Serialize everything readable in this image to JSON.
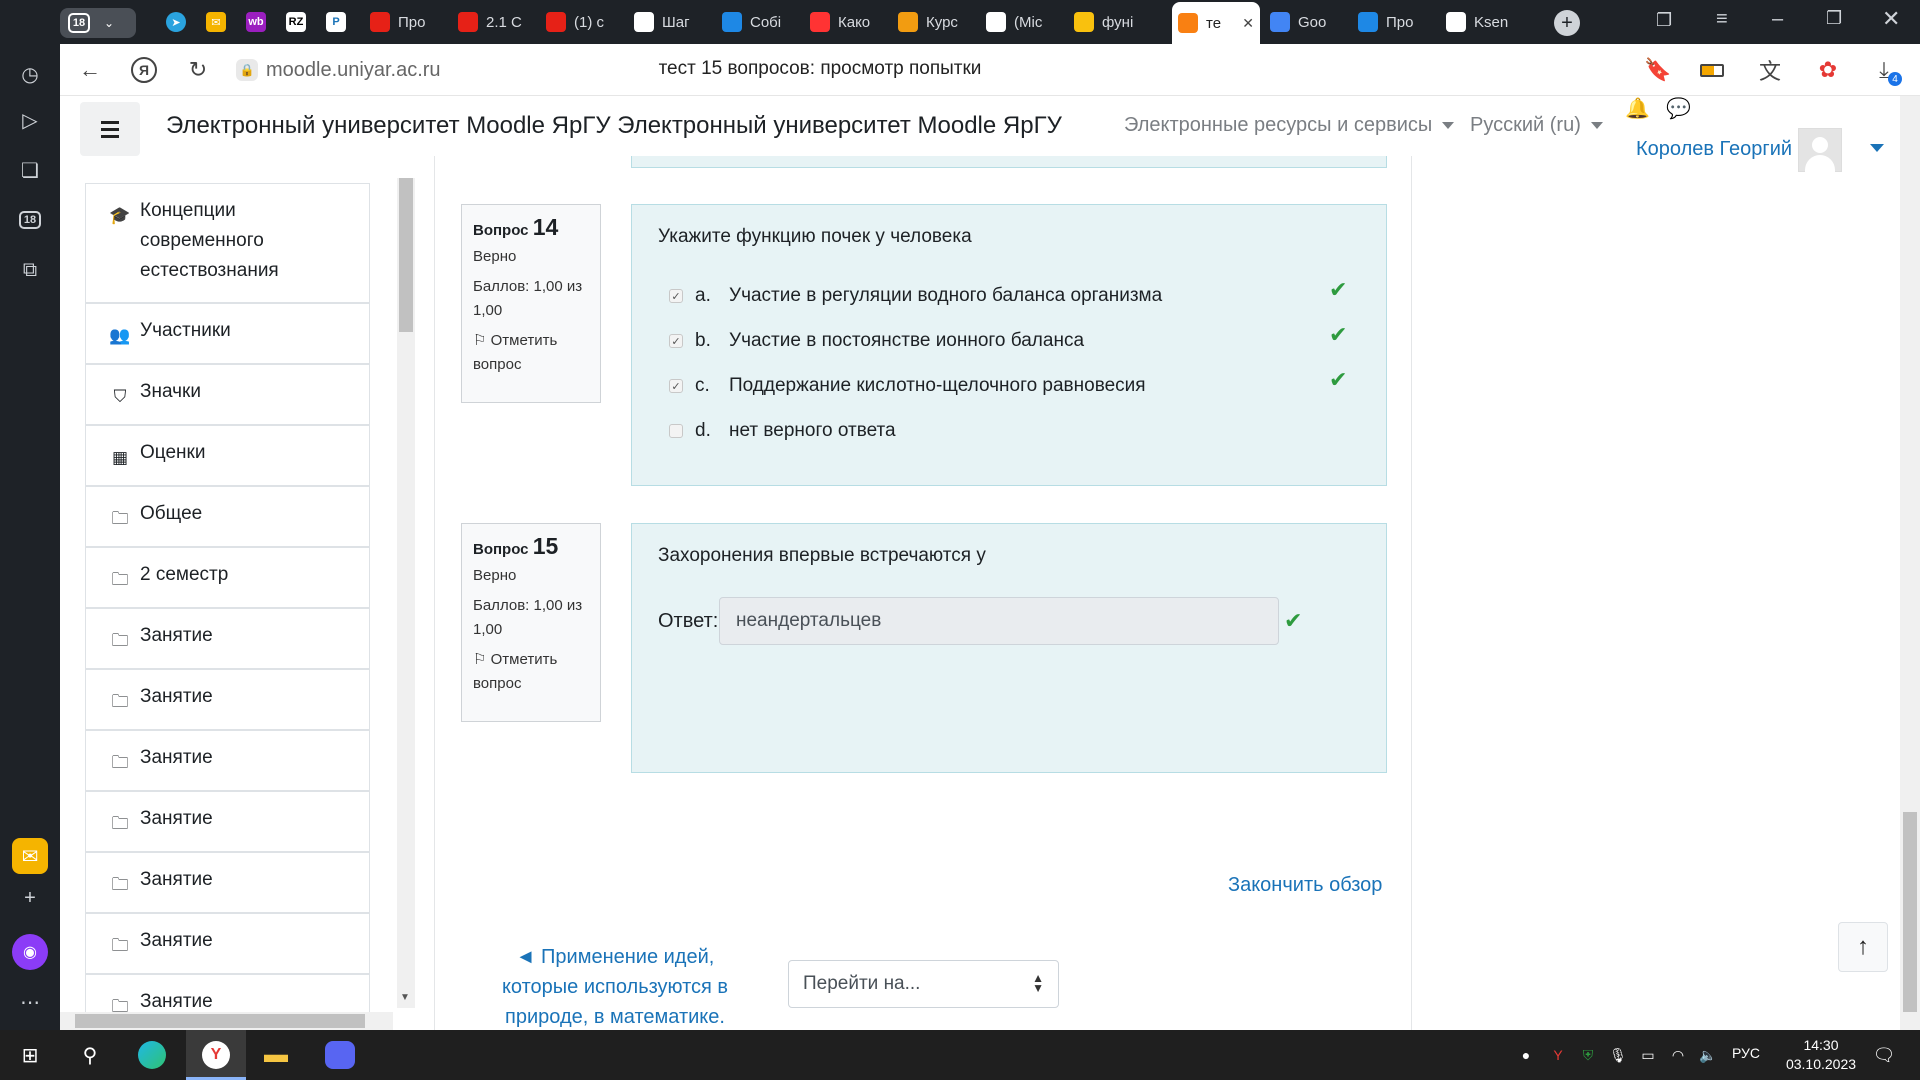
{
  "browser": {
    "tab_count": "18",
    "tabs": [
      {
        "label": "Про",
        "icon": "youtube-icon",
        "color": "#e62117"
      },
      {
        "label": "2.1 С",
        "icon": "youtube-icon",
        "color": "#e62117"
      },
      {
        "label": "(1) с",
        "icon": "youtube-icon",
        "color": "#e62117"
      },
      {
        "label": "Шаг",
        "icon": "link-icon",
        "color": "#ffffff"
      },
      {
        "label": "Собі",
        "icon": "code-icon",
        "color": "#1e88e5"
      },
      {
        "label": "Како",
        "icon": "yandex-icon",
        "color": "#f33"
      },
      {
        "label": "Курс",
        "icon": "course-icon",
        "color": "#f29c11"
      },
      {
        "label": "(Mic",
        "icon": "document-icon",
        "color": "#ffffff"
      },
      {
        "label": "фуні",
        "icon": "image-icon",
        "color": "#f9c10e"
      },
      {
        "label": "те",
        "icon": "moodle-icon",
        "color": "#f98012"
      },
      {
        "label": "Goo",
        "icon": "google-translate-icon",
        "color": "#4285f4"
      },
      {
        "label": "Про",
        "icon": "alice-icon",
        "color": "#1e88e5"
      },
      {
        "label": "Ksen",
        "icon": "github-icon",
        "color": "#ffffff"
      }
    ],
    "url": "moodle.uniyar.ac.ru",
    "page_title": "тест 15 вопросов: просмотр попытки",
    "download_badge": "4"
  },
  "navbar": {
    "brand": "Электронный университет Moodle ЯрГУ Электронный университет Moodle ЯрГУ",
    "menu_resources": "Электронные ресурсы и сервисы",
    "menu_language": "Русский ‎(ru)‎",
    "user_name": "Королев Георгий"
  },
  "drawer": {
    "items": [
      {
        "label": "Концепции современного естествознания",
        "icon": "graduation-cap-icon"
      },
      {
        "label": "Участники",
        "icon": "users-icon"
      },
      {
        "label": "Значки",
        "icon": "shield-icon"
      },
      {
        "label": "Оценки",
        "icon": "table-icon"
      },
      {
        "label": "Общее",
        "icon": "folder-icon"
      },
      {
        "label": "2 семестр",
        "icon": "folder-icon"
      },
      {
        "label": "Занятие",
        "icon": "folder-icon"
      },
      {
        "label": "Занятие",
        "icon": "folder-icon"
      },
      {
        "label": "Занятие",
        "icon": "folder-icon"
      },
      {
        "label": "Занятие",
        "icon": "folder-icon"
      },
      {
        "label": "Занятие",
        "icon": "folder-icon"
      },
      {
        "label": "Занятие",
        "icon": "folder-icon"
      },
      {
        "label": "Занятие",
        "icon": "folder-icon"
      }
    ]
  },
  "questions": [
    {
      "label": "Вопрос",
      "number": "14",
      "state": "Верно",
      "grade": "Баллов: 1,00 из 1,00",
      "flag": "Отметить вопрос",
      "text": "Укажите функцию почек у человека",
      "answers": [
        {
          "letter": "a.",
          "text": "Участие в регуляции водного баланса организма",
          "checked": true,
          "correct": true
        },
        {
          "letter": "b.",
          "text": "Участие в постоянстве ионного баланса",
          "checked": true,
          "correct": true
        },
        {
          "letter": "c.",
          "text": "Поддержание кислотно-щелочного равновесия",
          "checked": true,
          "correct": true
        },
        {
          "letter": "d.",
          "text": "нет верного ответа",
          "checked": false,
          "correct": false
        }
      ]
    },
    {
      "label": "Вопрос",
      "number": "15",
      "state": "Верно",
      "grade": "Баллов: 1,00 из 1,00",
      "flag": "Отметить вопрос",
      "text": "Захоронения впервые встречаются у",
      "answer_label": "Ответ:",
      "answer_value": "неандертальцев"
    }
  ],
  "footer": {
    "finish_review": "Закончить обзор",
    "prev_activity": "◄ Применение идей, которые используются в природе, в математике.",
    "jump_to": "Перейти на..."
  },
  "taskbar": {
    "language": "РУС",
    "time": "14:30",
    "date": "03.10.2023"
  },
  "colors": {
    "correct": "#2e9b3f",
    "link": "#1a73b8",
    "question_bg": "#e7f3f5"
  }
}
